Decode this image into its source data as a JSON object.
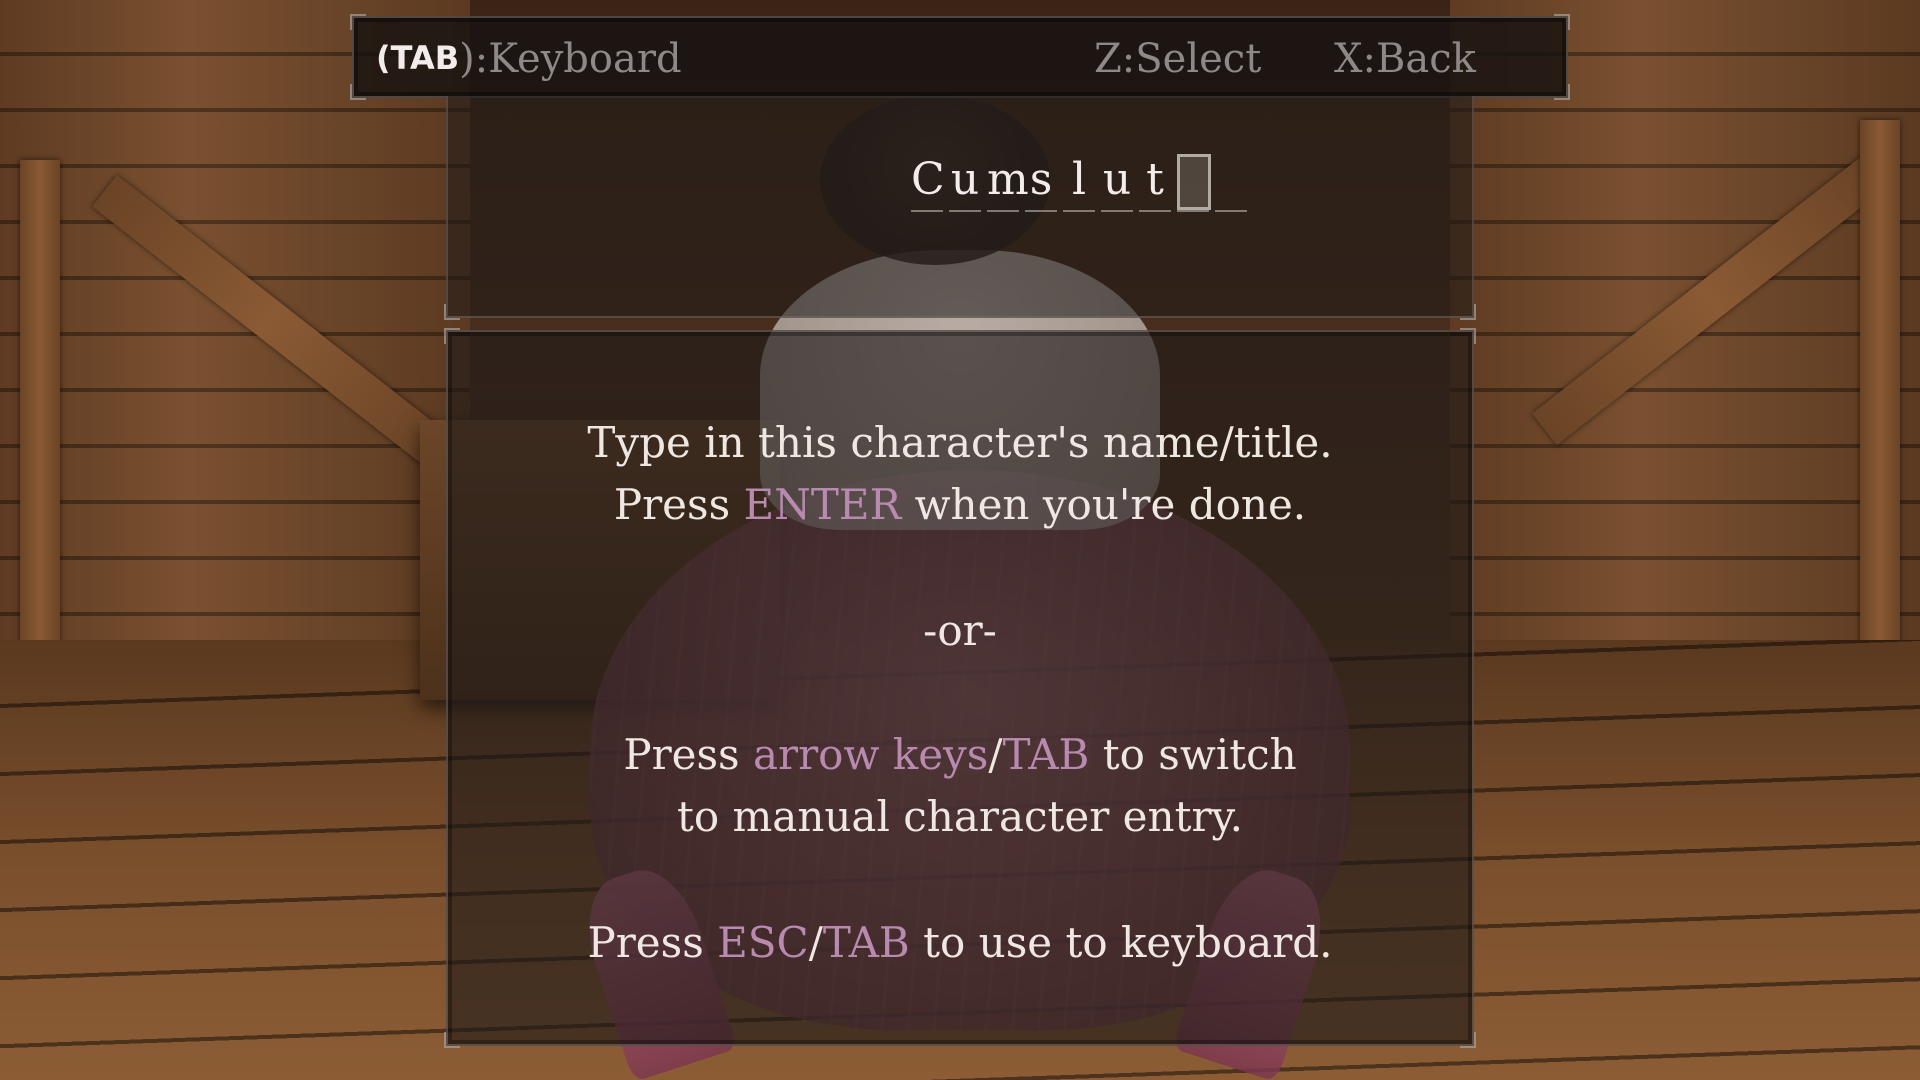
{
  "top_bar": {
    "keyboard_key": "(TAB",
    "keyboard_label": "):Keyboard",
    "select_label": "Z:Select",
    "back_label": "X:Back"
  },
  "name_entry": {
    "slots": [
      "C",
      "u",
      "m",
      "s",
      "l",
      "u",
      "t",
      "",
      ""
    ]
  },
  "instructions": {
    "line1": "Type in this character's name/title.",
    "line2_pre": "Press ",
    "line2_key": "ENTER",
    "line2_post": " when you're done.",
    "or": "-or-",
    "line4_pre": "Press ",
    "line4_key1": "arrow keys",
    "line4_sep": "/",
    "line4_key2": "TAB",
    "line4_post": " to switch",
    "line5": "to manual character entry.",
    "line6_pre": "Press ",
    "line6_key1": "ESC",
    "line6_sep": "/",
    "line6_key2": "TAB",
    "line6_post": " to use to keyboard."
  },
  "colors": {
    "accent": "#b98ab0",
    "text": "#efe7e2",
    "hint": "#8e8886"
  }
}
